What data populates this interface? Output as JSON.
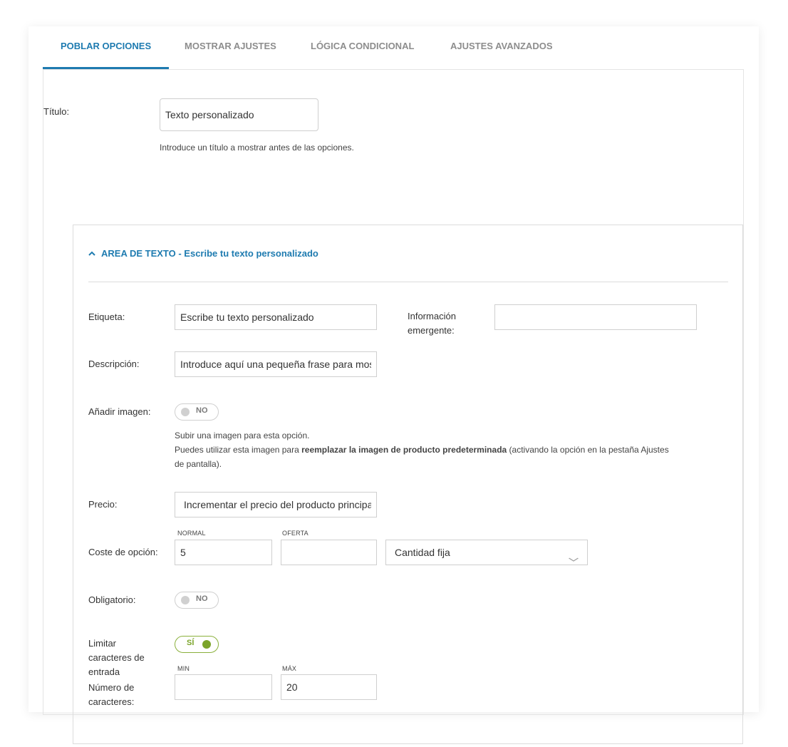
{
  "tabs": [
    {
      "label": "POBLAR OPCIONES",
      "active": true
    },
    {
      "label": "MOSTRAR AJUSTES",
      "active": false
    },
    {
      "label": "LÓGICA CONDICIONAL",
      "active": false
    },
    {
      "label": "AJUSTES AVANZADOS",
      "active": false
    }
  ],
  "title_field": {
    "label": "Título:",
    "value": "Texto personalizado",
    "help": "Introduce un título a mostrar antes de las opciones."
  },
  "section": {
    "header_prefix": "AREA DE TEXTO",
    "header_suffix": " - Escribe tu texto personalizado",
    "chevron_icon": "chevron-up-icon"
  },
  "fields": {
    "etiqueta_label": "Etiqueta:",
    "etiqueta_value": "Escribe tu texto personalizado",
    "tooltip_label_line1": "Información",
    "tooltip_label_line2": "emergente:",
    "tooltip_value": "",
    "descripcion_label": "Descripción:",
    "descripcion_value": "Introduce aquí una pequeña frase para mostrar",
    "imagen_label": "Añadir imagen:",
    "imagen_toggle": "NO",
    "imagen_help_line1": "Subir una imagen para esta opción.",
    "imagen_help_line2_pre": "Puedes utilizar esta imagen para ",
    "imagen_help_line2_bold": "reemplazar la imagen de producto predeterminada",
    "imagen_help_line2_post": " (activando la opción en la pestaña Ajustes",
    "imagen_help_line3": "de pantalla).",
    "precio_label": "Precio:",
    "precio_value": "Incrementar el precio del producto principal",
    "coste_label": "Coste de opción:",
    "normal_label": "NORMAL",
    "normal_value": "5",
    "oferta_label": "OFERTA",
    "oferta_value": "",
    "cantidad_value": "Cantidad fija",
    "obligatorio_label": "Obligatorio:",
    "obligatorio_toggle": "NO",
    "limitar_label_lines": [
      "Limitar",
      "caracteres de",
      "entrada"
    ],
    "limitar_toggle": "SÍ",
    "numero_label_lines": [
      "Número de",
      "caracteres:"
    ],
    "min_label": "MIN",
    "min_value": "",
    "max_label": "MÁX",
    "max_value": "20"
  },
  "colors": {
    "accent": "#1e7bb0",
    "toggle_on": "#7ba42a"
  }
}
